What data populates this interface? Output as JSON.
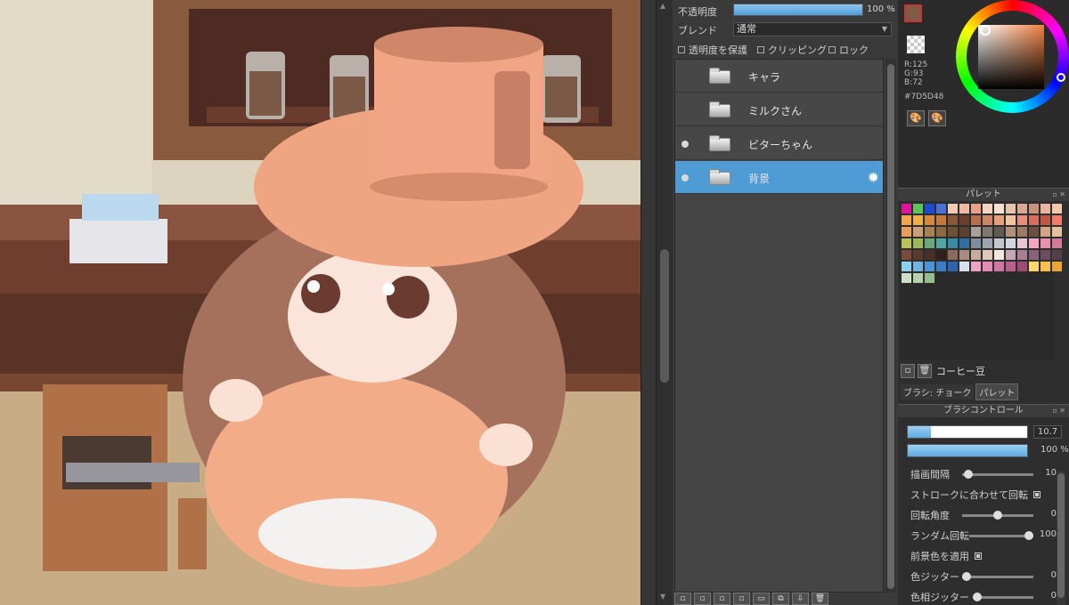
{
  "layer_panel": {
    "opacity_label": "不透明度",
    "opacity_value": "100 %",
    "opacity_fraction": 1.0,
    "blend_label": "ブレンド",
    "blend_value": "通常",
    "protect_alpha_label": "透明度を保護",
    "clipping_label": "クリッピング",
    "lock_label": "ロック",
    "layers": [
      {
        "name": "キャラ",
        "visible": false,
        "selected": false
      },
      {
        "name": "ミルクさん",
        "visible": false,
        "selected": false
      },
      {
        "name": "ビターちゃん",
        "visible": true,
        "selected": false
      },
      {
        "name": "背景",
        "visible": true,
        "selected": true
      }
    ]
  },
  "color": {
    "r_label": "R:125",
    "g_label": "G:93",
    "b_label": "B:72",
    "hex": "#7D5D48",
    "foreground": "#7d5d48",
    "background": "#ffffff"
  },
  "palette": {
    "title": "パレット",
    "name": "コーヒー豆",
    "colors": [
      "#e0139c",
      "#5bc55b",
      "#1b4bd6",
      "#4a72d6",
      "#f2c9b2",
      "#f0b9a1",
      "#e8a08a",
      "#f2d4c0",
      "#f6e0d2",
      "#e6c3ad",
      "#d8a891",
      "#c9907a",
      "#e7b49f",
      "#f5c6a8",
      "#f1a34d",
      "#efb046",
      "#d7893a",
      "#c47a3c",
      "#8a5838",
      "#6b3f2a",
      "#b86e4a",
      "#cd8665",
      "#e4a07c",
      "#f0c39c",
      "#e88d7a",
      "#d56d60",
      "#c05748",
      "#f27a6a",
      "#e6a05a",
      "#caa07a",
      "#a8824f",
      "#8d6842",
      "#6f5236",
      "#5a4230",
      "#a9a09a",
      "#807870",
      "#605a55",
      "#b2917a",
      "#9e7b64",
      "#6e5040",
      "#d2a588",
      "#e4c0a0",
      "#b7c25a",
      "#9bb85a",
      "#6aa878",
      "#4ea7a2",
      "#3a8aa5",
      "#2f6fa1",
      "#7e8d9c",
      "#9aa5b0",
      "#c2c7ce",
      "#d3d6dc",
      "#e8c5d0",
      "#f2a7c0",
      "#e98fb0",
      "#d4799a",
      "#7a4a3d",
      "#5a3a2e",
      "#4a2f27",
      "#2f1e19",
      "#8a6b5d",
      "#a98a7c",
      "#c8ad9e",
      "#dcc8bb",
      "#f3e8e0",
      "#c9a4b5",
      "#a97e94",
      "#8b6378",
      "#6b4d5e",
      "#533e4a",
      "#8fcff0",
      "#6fb3e4",
      "#4a95d8",
      "#3d7cc6",
      "#2e63ae",
      "#d7e0ec",
      "#f0a2c6",
      "#e58ab3",
      "#cf76a2",
      "#ba5f8c",
      "#9e4c77",
      "#ffd76b",
      "#f7c04f",
      "#eca535",
      "#cfe0c9",
      "#b6d2ad",
      "#95bf8a"
    ],
    "tab_brush": "ブラシ: チョーク",
    "tab_palette": "パレット"
  },
  "brush_control": {
    "title": "ブラシコントロール",
    "size_value": "10.7",
    "size_fraction": 0.19,
    "opacity_value": "100 %",
    "rows": [
      {
        "label": "描画間隔",
        "value": "10",
        "fraction": 0.05
      },
      {
        "label": "ストロークに合わせて回転",
        "checked": true
      },
      {
        "label": "回転角度",
        "value": "0",
        "fraction": 0.5
      },
      {
        "label": "ランダム回転",
        "value": "100",
        "fraction": 1.0
      },
      {
        "label": "前景色を適用",
        "checked": true
      },
      {
        "label": "色ジッター",
        "value": "0",
        "fraction": 0.0
      },
      {
        "label": "色相ジッター",
        "value": "0",
        "fraction": 0.0
      }
    ]
  }
}
